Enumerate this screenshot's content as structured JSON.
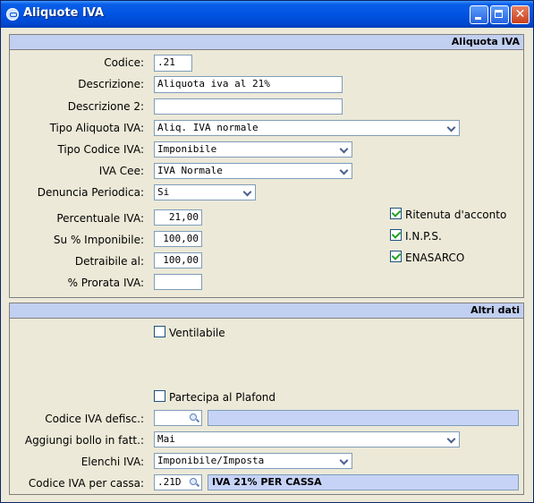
{
  "window": {
    "title": "Aliquote IVA"
  },
  "section1": {
    "header": "Aliquota IVA",
    "codice": {
      "label": "Codice:",
      "value": ".21"
    },
    "descrizione": {
      "label": "Descrizione:",
      "value": "Aliquota iva al 21%"
    },
    "descrizione2": {
      "label": "Descrizione 2:",
      "value": ""
    },
    "tipo_aliquota": {
      "label": "Tipo Aliquota IVA:",
      "value": "Aliq. IVA normale"
    },
    "tipo_codice": {
      "label": "Tipo Codice IVA:",
      "value": "Imponibile"
    },
    "iva_cee": {
      "label": "IVA Cee:",
      "value": "IVA Normale"
    },
    "denuncia": {
      "label": "Denuncia Periodica:",
      "value": "Si"
    },
    "percentuale": {
      "label": "Percentuale IVA:",
      "value": "21,00"
    },
    "su_imponibile": {
      "label": "Su % Imponibile:",
      "value": "100,00"
    },
    "detraibile": {
      "label": "Detraibile al:",
      "value": "100,00"
    },
    "prorata": {
      "label": "% Prorata IVA:",
      "value": ""
    },
    "ritenuta": {
      "label": "Ritenuta d'acconto",
      "checked": true
    },
    "inps": {
      "label": "I.N.P.S.",
      "checked": true
    },
    "enasarco": {
      "label": "ENASARCO",
      "checked": true
    }
  },
  "section2": {
    "header": "Altri dati",
    "ventilabile": {
      "label": "Ventilabile",
      "checked": false
    },
    "plafond": {
      "label": "Partecipa al Plafond",
      "checked": false
    },
    "codice_defisc": {
      "label": "Codice IVA defisc.:",
      "value": "",
      "description": ""
    },
    "bollo": {
      "label": "Aggiungi bollo in fatt.:",
      "value": "Mai"
    },
    "elenchi": {
      "label": "Elenchi IVA:",
      "value": "Imponibile/Imposta"
    },
    "codice_cassa": {
      "label": "Codice IVA per cassa:",
      "value": ".21D",
      "description": "IVA 21% PER CASSA"
    }
  }
}
